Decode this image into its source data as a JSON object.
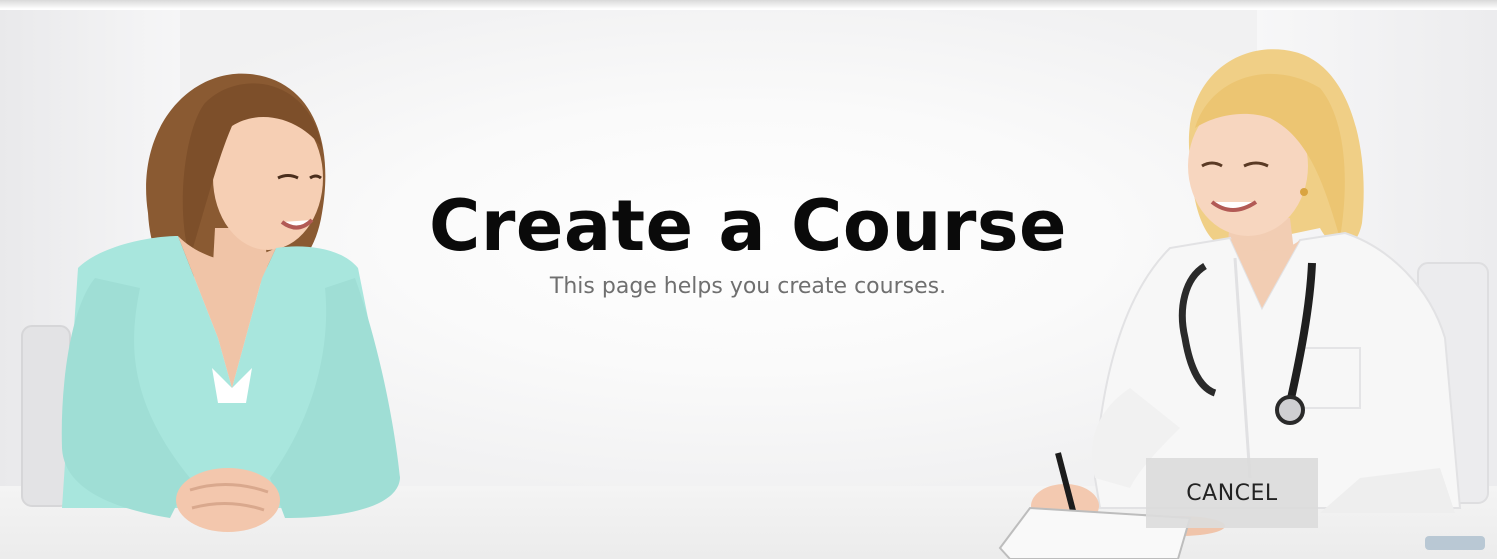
{
  "header": {
    "title": "Create a Course",
    "subtitle": "This page helps you create courses."
  },
  "actions": {
    "cancel_label": "CANCEL"
  },
  "colors": {
    "title": "#0a0a0a",
    "subtitle": "#6f6f6f",
    "cancel_bg": "#dcdcdc",
    "patient_top": "#a8e6dd",
    "doctor_coat": "#f7f7f7",
    "doctor_hair": "#f0cf86",
    "patient_hair": "#8a5a32"
  }
}
